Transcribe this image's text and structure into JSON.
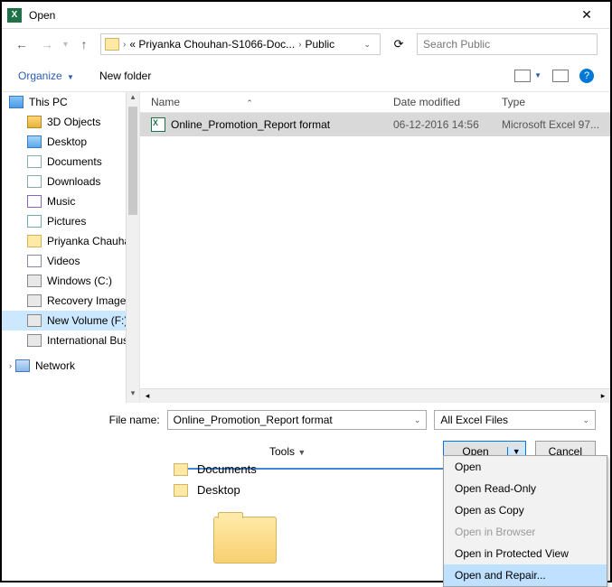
{
  "window": {
    "title": "Open"
  },
  "nav": {
    "crumb1": "« Priyanka Chouhan-S1066-Doc...",
    "crumb2": "Public",
    "search_placeholder": "Search Public"
  },
  "toolbar": {
    "organize": "Organize",
    "newfolder": "New folder"
  },
  "tree": {
    "thispc": "This PC",
    "items": [
      "3D Objects",
      "Desktop",
      "Documents",
      "Downloads",
      "Music",
      "Pictures",
      "Priyanka Chauha",
      "Videos",
      "Windows (C:)",
      "Recovery Image",
      "New Volume (F:)",
      "International Bus"
    ],
    "network": "Network"
  },
  "columns": {
    "name": "Name",
    "date": "Date modified",
    "type": "Type"
  },
  "files": [
    {
      "name": "Online_Promotion_Report  format",
      "date": "06-12-2016 14:56",
      "type": "Microsoft Excel 97..."
    }
  ],
  "footer": {
    "filename_label": "File name:",
    "filename_value": "Online_Promotion_Report  format",
    "filter_value": "All Excel Files",
    "tools": "Tools",
    "open": "Open",
    "cancel": "Cancel"
  },
  "menu": {
    "items": [
      "Open",
      "Open Read-Only",
      "Open as Copy",
      "Open in Browser",
      "Open in Protected View",
      "Open and Repair..."
    ]
  },
  "under": {
    "documents": "Documents",
    "desktop": "Desktop"
  }
}
